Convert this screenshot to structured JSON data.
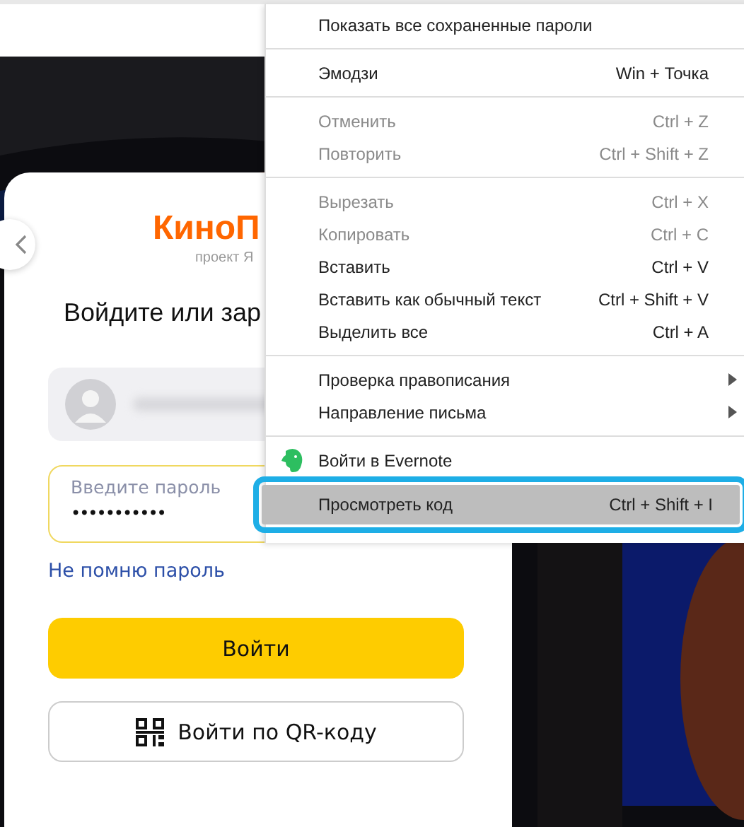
{
  "login": {
    "logo": "КиноП",
    "logo_caption": "проект Я",
    "heading": "Войдите или зар",
    "account": {
      "kind": "blurred"
    },
    "password": {
      "placeholder": "Введите пароль",
      "value": "•••••••••••"
    },
    "forgot_link": "Не помню пароль",
    "submit_button": "Войти",
    "qr_button": "Войти по QR-коду"
  },
  "context_menu": {
    "sections": [
      [
        {
          "label": "Показать все сохраненные пароли",
          "disabled": false,
          "selected": false
        }
      ],
      [
        {
          "label": "Эмодзи",
          "shortcut": "Win + Точка",
          "disabled": false,
          "selected": false
        }
      ],
      [
        {
          "label": "Отменить",
          "shortcut": "Ctrl + Z",
          "disabled": true,
          "selected": false
        },
        {
          "label": "Повторить",
          "shortcut": "Ctrl + Shift + Z",
          "disabled": true,
          "selected": false
        }
      ],
      [
        {
          "label": "Вырезать",
          "shortcut": "Ctrl + X",
          "disabled": true,
          "selected": false
        },
        {
          "label": "Копировать",
          "shortcut": "Ctrl + C",
          "disabled": true,
          "selected": false
        },
        {
          "label": "Вставить",
          "shortcut": "Ctrl + V",
          "disabled": false,
          "selected": false
        },
        {
          "label": "Вставить как обычный текст",
          "shortcut": "Ctrl + Shift + V",
          "disabled": false,
          "selected": false
        },
        {
          "label": "Выделить все",
          "shortcut": "Ctrl + A",
          "disabled": false,
          "selected": false
        }
      ],
      [
        {
          "label": "Проверка правописания",
          "submenu": true,
          "disabled": false,
          "selected": false
        },
        {
          "label": "Направление письма",
          "submenu": true,
          "disabled": false,
          "selected": false
        }
      ],
      [
        {
          "label": "Войти в Evernote",
          "kind": "evernote",
          "disabled": false,
          "selected": false
        },
        {
          "label": "Просмотреть код",
          "shortcut": "Ctrl + Shift + I",
          "disabled": false,
          "selected": true
        }
      ]
    ]
  }
}
